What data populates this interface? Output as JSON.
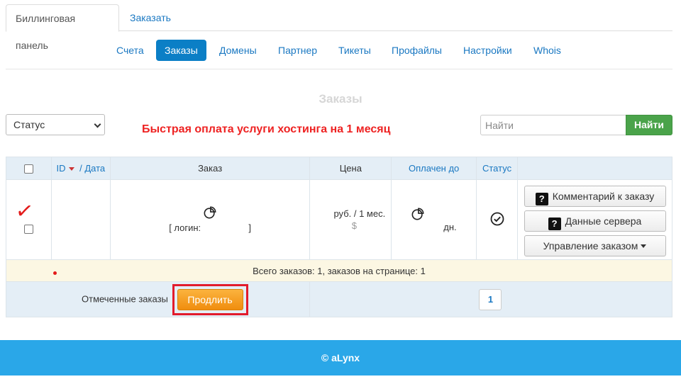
{
  "top_tabs": [
    {
      "label": "Биллинговая панель",
      "active": true
    },
    {
      "label": "Заказать",
      "active": false
    }
  ],
  "subnav": [
    {
      "label": "Счета"
    },
    {
      "label": "Заказы",
      "active": true
    },
    {
      "label": "Домены"
    },
    {
      "label": "Партнер"
    },
    {
      "label": "Тикеты"
    },
    {
      "label": "Профайлы"
    },
    {
      "label": "Настройки"
    },
    {
      "label": "Whois"
    }
  ],
  "section_title": "Заказы",
  "filter": {
    "status_selected": "Статус"
  },
  "promo_text": "Быстрая оплата услуги хостинга на 1 месяц",
  "search": {
    "placeholder": "Найти",
    "button_label": "Найти"
  },
  "table": {
    "headers": {
      "id": "ID",
      "id_sep": " / ",
      "date": "Дата",
      "order": "Заказ",
      "price": "Цена",
      "paid_until": "Оплачен до",
      "status": "Статус"
    },
    "row": {
      "login_prefix": "[ логин:",
      "login_suffix": "]",
      "price_line1": "руб. / 1 мес.",
      "price_line2": "$",
      "paid_until_suffix": "дн.",
      "actions": {
        "comment": "Комментарий к заказу",
        "server_data": "Данные сервера",
        "manage": "Управление заказом"
      }
    },
    "summary": "Всего заказов: 1, заказов на странице: 1",
    "marked_label": "Отмеченные заказы",
    "renew_label": "Продлить",
    "page_number": "1"
  },
  "footer": "© aLynx",
  "colors": {
    "accent": "#0b7fc6",
    "promo": "#e22222",
    "search_button": "#4aa34a",
    "renew_button": "#f5a024",
    "footer": "#2aa7e8"
  }
}
